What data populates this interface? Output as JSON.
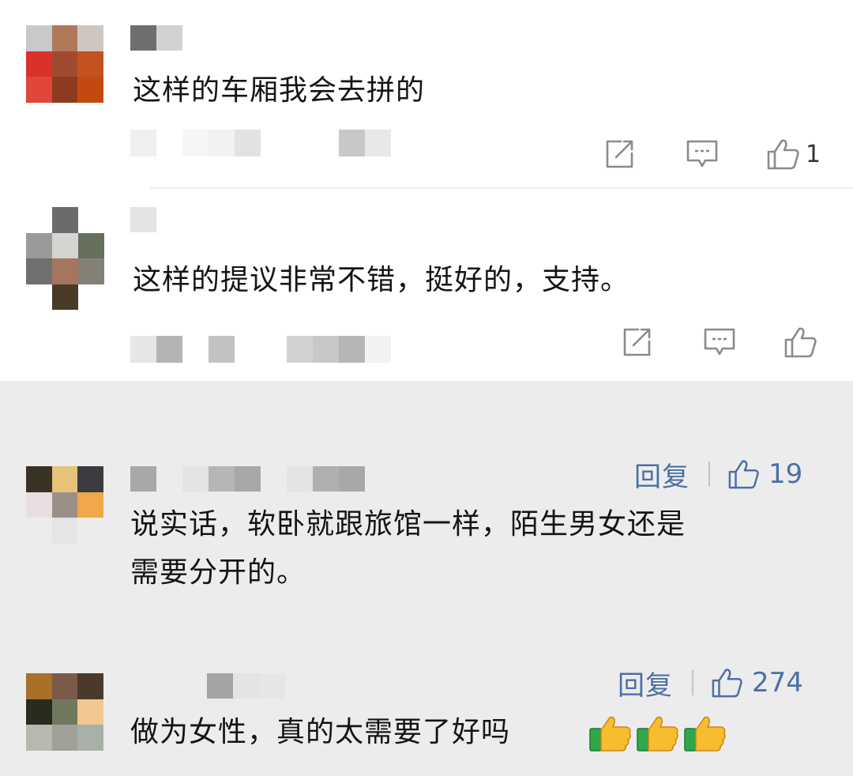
{
  "icons": {
    "share": "share-icon",
    "comment": "comment-icon",
    "like": "thumbs-up-icon",
    "emoji": "thumbs-up-emoji"
  },
  "colors": {
    "top_background": "#ffffff",
    "bottom_background": "#ececec",
    "text": "#141414",
    "link_blue": "#4c6fa4",
    "icon_gray": "#8a8a8a"
  },
  "weibo_comments": [
    {
      "text": "这样的车厢我会去拼的",
      "like_count": "1"
    },
    {
      "text": "这样的提议非常不错，挺好的，支持。",
      "like_count": ""
    }
  ],
  "app_comments": [
    {
      "text_line1": "说实话，软卧就跟旅馆一样，陌生男女还是",
      "text_line2": "需要分开的。",
      "reply_label": "回复",
      "like_count": "19"
    },
    {
      "text": "做为女性，真的太需要了好吗",
      "reply_label": "回复",
      "like_count": "274",
      "emoji_count": 3
    }
  ]
}
